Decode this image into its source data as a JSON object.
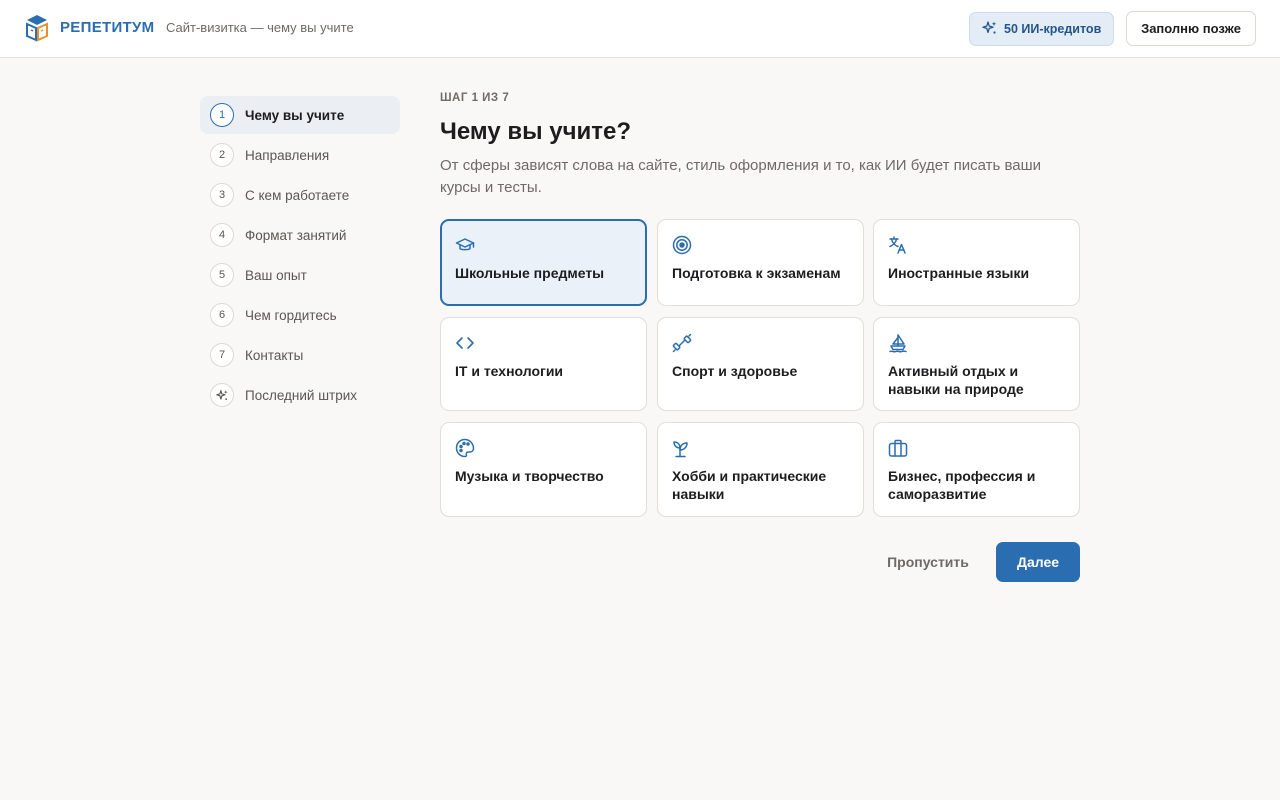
{
  "header": {
    "brand": "РЕПЕТИТУМ",
    "subtitle": "Сайт-визитка — чему вы учите",
    "credits_label": "50 ИИ-кредитов",
    "later_label": "Заполню позже",
    "logo_icon": "book-cube-logo-icon"
  },
  "sidebar": {
    "steps": [
      {
        "num": "1",
        "label": "Чему вы учите",
        "active": true
      },
      {
        "num": "2",
        "label": "Направления"
      },
      {
        "num": "3",
        "label": "С кем работаете"
      },
      {
        "num": "4",
        "label": "Формат занятий"
      },
      {
        "num": "5",
        "label": "Ваш опыт"
      },
      {
        "num": "6",
        "label": "Чем гордитесь"
      },
      {
        "num": "7",
        "label": "Контакты"
      },
      {
        "num": "",
        "label": "Последний штрих",
        "icon": "sparkles-icon"
      }
    ]
  },
  "main": {
    "step_counter": "ШАГ 1 ИЗ 7",
    "title": "Чему вы учите?",
    "description": "От сферы зависят слова на сайте, стиль оформления и то, как ИИ будет писать ваши курсы и тесты.",
    "options": [
      {
        "label": "Школьные предметы",
        "icon": "graduation-cap-icon",
        "selected": true
      },
      {
        "label": "Подготовка к экзаменам",
        "icon": "target-icon"
      },
      {
        "label": "Иностранные языки",
        "icon": "translate-icon"
      },
      {
        "label": "IT и технологии",
        "icon": "code-icon"
      },
      {
        "label": "Спорт и здоровье",
        "icon": "dumbbell-icon"
      },
      {
        "label": "Активный отдых и навыки на природе",
        "icon": "sailboat-icon"
      },
      {
        "label": "Музыка и творчество",
        "icon": "palette-icon"
      },
      {
        "label": "Хобби и практические навыки",
        "icon": "sprout-icon"
      },
      {
        "label": "Бизнес, профессия и саморазвитие",
        "icon": "briefcase-icon"
      }
    ],
    "skip_label": "Пропустить",
    "next_label": "Далее"
  },
  "colors": {
    "accent": "#2a6db0",
    "background": "#faf8f6",
    "selected_card_bg": "#eaf1f9",
    "credits_bg": "#e4edf6"
  }
}
